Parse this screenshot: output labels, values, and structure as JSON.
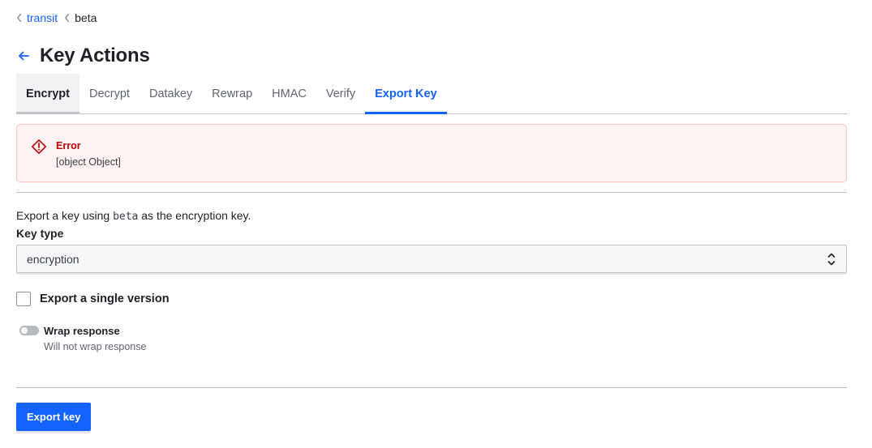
{
  "breadcrumb": {
    "items": [
      {
        "label": "transit"
      },
      {
        "label": "beta"
      }
    ]
  },
  "header": {
    "title": "Key Actions"
  },
  "tabs": [
    {
      "label": "Encrypt"
    },
    {
      "label": "Decrypt"
    },
    {
      "label": "Datakey"
    },
    {
      "label": "Rewrap"
    },
    {
      "label": "HMAC"
    },
    {
      "label": "Verify"
    },
    {
      "label": "Export Key"
    }
  ],
  "alert": {
    "title": "Error",
    "message": "[object Object]"
  },
  "form": {
    "description_prefix": "Export a key using ",
    "description_key": "beta",
    "description_suffix": " as the encryption key.",
    "key_type_label": "Key type",
    "key_type_value": "encryption",
    "single_version_label": "Export a single version",
    "wrap_label": "Wrap response",
    "wrap_help": "Will not wrap response",
    "submit_label": "Export key"
  },
  "colors": {
    "accent": "#1563ff",
    "error": "#c00005",
    "error_bg": "#fff3f3"
  },
  "icons": {
    "breadcrumb_separator": "chevron-left-icon",
    "back": "arrow-left-icon",
    "alert": "alert-diamond-icon",
    "select": "chevron-up-down-icon"
  }
}
